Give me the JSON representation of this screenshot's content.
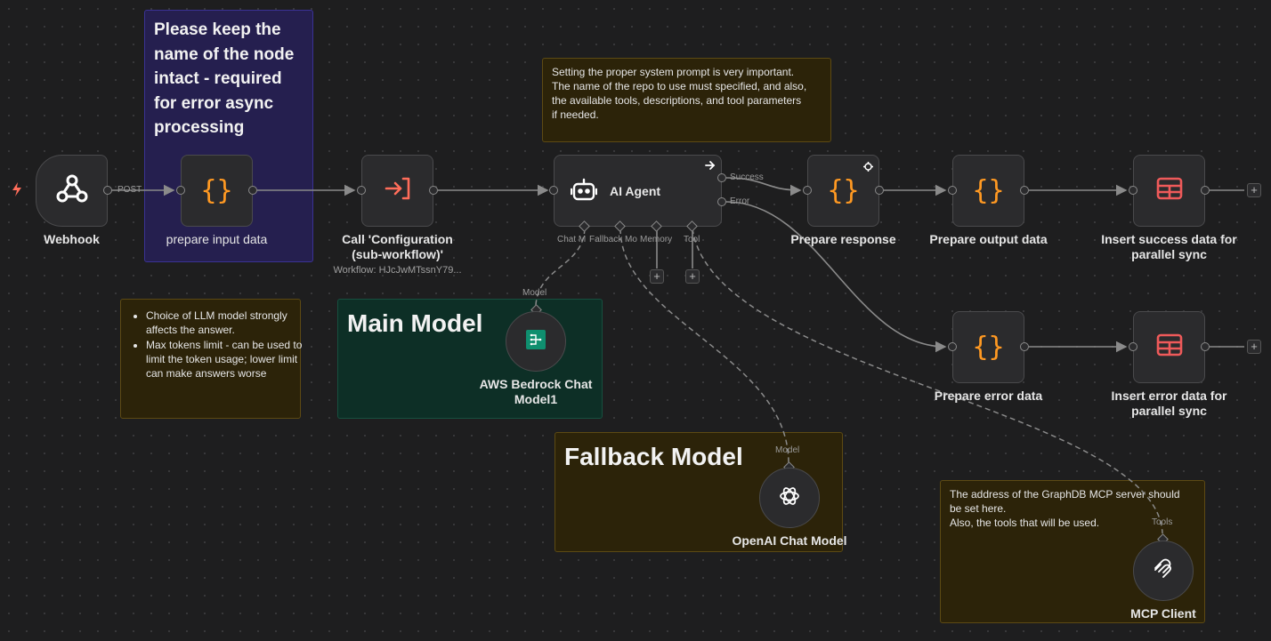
{
  "colors": {
    "canvas": "#1e1e1f",
    "node_bg": "#2b2b2d",
    "code_orange": "#ff9922",
    "table_red": "#ef5a5a",
    "execute_red": "#ff6d5a",
    "trigger_bolt": "#ff6d5a",
    "sticky_purple": "#251f4f",
    "sticky_brown": "#2c2309",
    "sticky_green": "#0d2f26"
  },
  "stickies": {
    "name_note": "Please keep the name of the node intact - required for error async processing",
    "prompt_note": [
      "Setting the proper system prompt is very important.",
      "The name of the repo to use must specified, and also,",
      "the available tools, descriptions, and tool parameters",
      "if needed."
    ],
    "llm_note": [
      "Choice of LLM model strongly affects the answer.",
      "Max tokens limit - can be used to limit the token usage; lower limit can make answers worse"
    ],
    "main_model_title": "Main Model",
    "fallback_model_title": "Fallback Model",
    "mcp_note": [
      "The address of the GraphDB MCP server should",
      "be set here.",
      "Also, the tools that will be used."
    ]
  },
  "nodes": {
    "webhook": {
      "label": "Webhook",
      "icon": "webhook-icon",
      "edge_label": "POST"
    },
    "prepare_input": {
      "label": "prepare input data",
      "icon": "code-braces-icon"
    },
    "call_config": {
      "label": "Call 'Configuration (sub-workflow)'",
      "subtitle": "Workflow: HJcJwMTssnY79...",
      "icon": "execute-workflow-icon"
    },
    "ai_agent": {
      "label": "AI Agent",
      "icon": "robot-icon",
      "out_success": "Success",
      "out_error": "Error",
      "inputs": [
        "Chat M",
        "Fallback Mo",
        "Memory",
        "Tool"
      ]
    },
    "prepare_response": {
      "label": "Prepare response",
      "icon": "code-braces-icon"
    },
    "prepare_output": {
      "label": "Prepare output data",
      "icon": "code-braces-icon"
    },
    "insert_success": {
      "label": "Insert success data for parallel sync",
      "icon": "table-icon"
    },
    "prepare_error": {
      "label": "Prepare error data",
      "icon": "code-braces-icon"
    },
    "insert_error": {
      "label": "Insert error data for parallel sync",
      "icon": "table-icon"
    },
    "bedrock": {
      "label": "AWS Bedrock Chat Model1",
      "icon": "bedrock-icon",
      "port_label": "Model"
    },
    "openai": {
      "label": "OpenAI Chat Model",
      "icon": "openai-icon",
      "port_label": "Model"
    },
    "mcp": {
      "label": "MCP Client",
      "icon": "mcp-icon",
      "port_label": "Tools"
    }
  },
  "add_button_symbol": "+",
  "code_glyph": "{}"
}
